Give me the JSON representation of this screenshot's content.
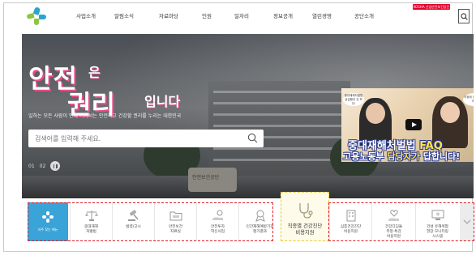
{
  "header": {
    "nav": [
      "사업소개",
      "알림소식",
      "자료마당",
      "인원",
      "일자리",
      "정보공개",
      "열린경영",
      "공단소개"
    ],
    "badge": "KOSHA 산업안전보건공단",
    "colors": {
      "logo_blue": "#2ba6cb",
      "logo_green": "#8cc63f"
    }
  },
  "hero": {
    "headline_1": "안전",
    "headline_1_small": "은",
    "headline_2": "권리",
    "headline_2_small": "입니다",
    "subtitle": "일하는 모든 사람이 언제 어디서는 안전하고 건강할 권리를 누리는 대한민국",
    "search_placeholder": "검색어를 입력해 주세요.",
    "pager": {
      "current": "01",
      "next": "02"
    },
    "stone_text": "안전보건공단"
  },
  "video": {
    "title_line_1_a": "중대재해처벌법 ",
    "title_line_1_b": "FAQ",
    "title_line_2_a": "고용노동부 ",
    "title_line_2_b": "담당자가",
    "title_line_2_c": " 답합니다!",
    "bubble_left": "중대재해처벌법 궁금했던 것 모두!",
    "bubble_right": "이정희 한 번 해볼게요"
  },
  "quick_menu": {
    "first_label": "자주 찾는 메뉴",
    "items": [
      {
        "label": "중대재해\n처벌법",
        "icon": "scale-icon"
      },
      {
        "label": "법령/고시",
        "icon": "gavel-icon"
      },
      {
        "label": "안전보건\n자료실",
        "icon": "folder-icon"
      },
      {
        "label": "안전투자\n혁신사업",
        "icon": "coin-hand-icon"
      },
      {
        "label": "인간재해예방기관\n평가결과",
        "icon": "award-icon"
      },
      {
        "label": "직종별 건강진단\n비용지원",
        "icon": "stethoscope-icon",
        "highlight": true
      },
      {
        "label": "심층건강진단\n비용지원",
        "icon": "building-icon"
      },
      {
        "label": "건강디딤돌\n측정·특검\n비용지원",
        "icon": "heart-hand-icon"
      },
      {
        "label": "건설 유해위험\n현장 모니터링\n시스템",
        "icon": "monitor-icon"
      }
    ]
  }
}
